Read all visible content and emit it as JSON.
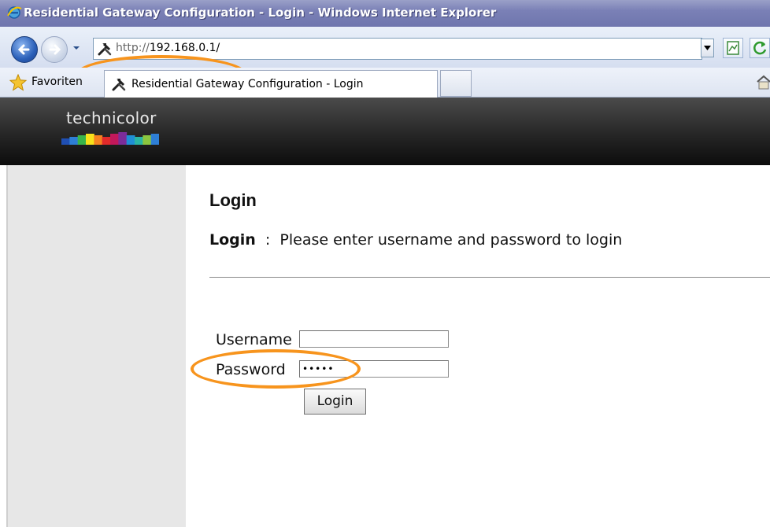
{
  "window": {
    "title": "Residential Gateway Configuration - Login - Windows Internet Explorer"
  },
  "navigation": {
    "url_protocol": "http://",
    "url_host": "192.168.0.1/"
  },
  "favorites_bar": {
    "favorites_label": "Favoriten",
    "active_tab_label": "Residential Gateway Configuration - Login"
  },
  "brand": {
    "name": "technicolor",
    "stripe_colors": [
      "#1f4fb3",
      "#2e7fd6",
      "#39b54a",
      "#f7e11a",
      "#f58220",
      "#e12a2a",
      "#c2185b",
      "#7b2d9a",
      "#1f8fd6",
      "#2ab5a5",
      "#8cc63f",
      "#2e7fd6"
    ]
  },
  "login": {
    "heading": "Login",
    "info_label": "Login",
    "info_separator": ":",
    "info_text": "Please enter username and password to login",
    "username_label": "Username",
    "username_value": "",
    "password_label": "Password",
    "password_value": "•••••",
    "login_button": "Login"
  },
  "annotations": {
    "highlight_color": "#f7941d"
  }
}
